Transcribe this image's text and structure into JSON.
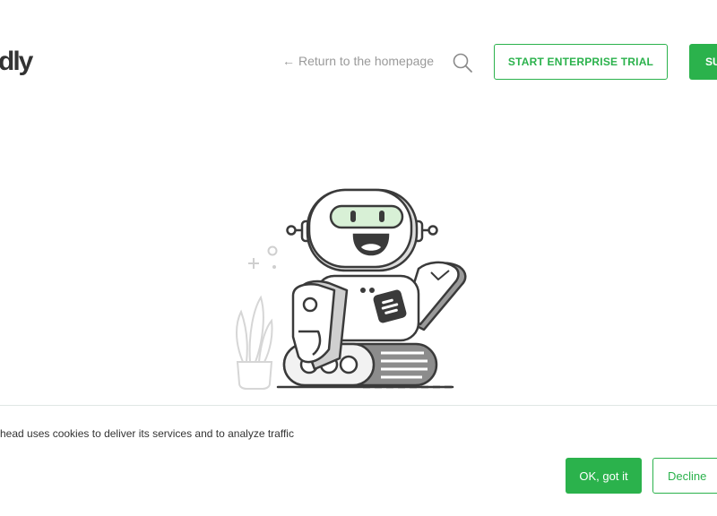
{
  "header": {
    "logo_text": "dly",
    "return_arrow": "←",
    "return_label": "Return to the homepage",
    "search_icon": "search-icon",
    "enterprise_label": "START ENTERPRISE TRIAL",
    "signup_label": "SU"
  },
  "illustration": {
    "subject": "robot-waving-icon",
    "badge_icon": "feedly-logo-icon",
    "plant_icon": "plant-icon"
  },
  "cookie": {
    "message": "head uses cookies to deliver its services and to analyze traffic",
    "ok_label": "OK, got it",
    "decline_label": "Decline"
  },
  "colors": {
    "accent": "#2bb24c",
    "text": "#333333",
    "muted": "#9a9a9a",
    "visor": "#d8f0d6"
  }
}
